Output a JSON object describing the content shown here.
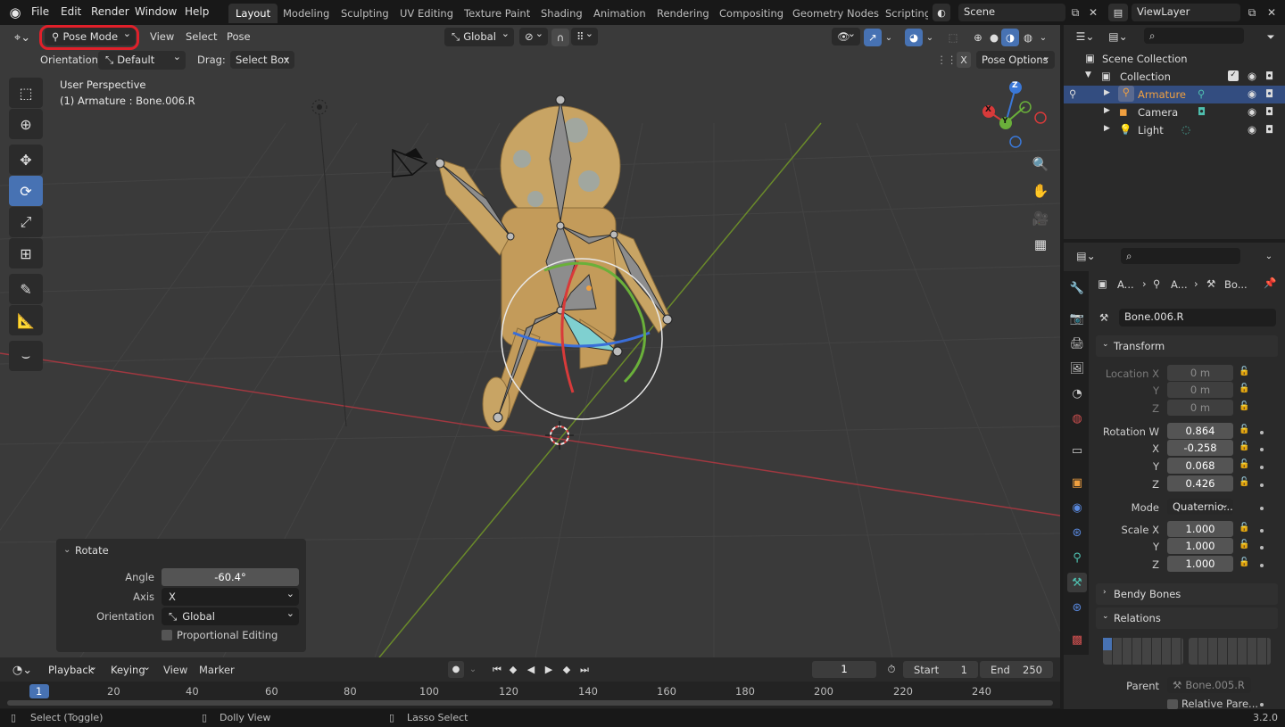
{
  "topbar": {
    "menus": [
      "File",
      "Edit",
      "Render",
      "Window",
      "Help"
    ],
    "workspaces": [
      "Layout",
      "Modeling",
      "Sculpting",
      "UV Editing",
      "Texture Paint",
      "Shading",
      "Animation",
      "Rendering",
      "Compositing",
      "Geometry Nodes",
      "Scripting"
    ],
    "active_workspace": "Layout",
    "scene": "Scene",
    "view_layer": "ViewLayer"
  },
  "viewport_header": {
    "mode": "Pose Mode",
    "menus": [
      "View",
      "Select",
      "Pose"
    ],
    "transform_orientation": "Global",
    "orientation_label": "Orientation:",
    "orientation_value": "Default",
    "drag_label": "Drag:",
    "drag_value": "Select Box",
    "x_toggle": "X",
    "pose_options": "Pose Options"
  },
  "viewport": {
    "perspective": "User Perspective",
    "active_info": "(1) Armature : Bone.006.R",
    "gizmo_axes": {
      "x": "X",
      "y": "Y",
      "z": "Z"
    }
  },
  "redo_panel": {
    "title": "Rotate",
    "angle_label": "Angle",
    "angle_value": "-60.4°",
    "axis_label": "Axis",
    "axis_value": "X",
    "orientation_label": "Orientation",
    "orientation_value": "Global",
    "proportional_label": "Proportional Editing"
  },
  "timeline": {
    "menus": [
      "Playback",
      "Keying",
      "View",
      "Marker"
    ],
    "current_frame": "1",
    "start_label": "Start",
    "start_value": "1",
    "end_label": "End",
    "end_value": "250",
    "ruler": [
      "1",
      "20",
      "40",
      "60",
      "80",
      "100",
      "120",
      "140",
      "160",
      "180",
      "200",
      "220",
      "240"
    ]
  },
  "statusbar": {
    "hint1": "Select (Toggle)",
    "hint2": "Dolly View",
    "hint3": "Lasso Select",
    "version": "3.2.0"
  },
  "outliner": {
    "root": "Scene Collection",
    "collection": "Collection",
    "items": [
      "Armature",
      "Camera",
      "Light"
    ]
  },
  "properties": {
    "breadcrumb": [
      "A...",
      "A...",
      "Bo..."
    ],
    "bone_name": "Bone.006.R",
    "transform_title": "Transform",
    "location_labels": [
      "Location X",
      "Y",
      "Z"
    ],
    "location_values": [
      "0 m",
      "0 m",
      "0 m"
    ],
    "rotation_labels": [
      "Rotation W",
      "X",
      "Y",
      "Z"
    ],
    "rotation_values": [
      "0.864",
      "-0.258",
      "0.068",
      "0.426"
    ],
    "mode_label": "Mode",
    "mode_value": "Quaternio...",
    "scale_labels": [
      "Scale X",
      "Y",
      "Z"
    ],
    "scale_values": [
      "1.000",
      "1.000",
      "1.000"
    ],
    "bendy_bones": "Bendy Bones",
    "relations": "Relations",
    "parent_label": "Parent",
    "parent_value": "Bone.005.R",
    "relative_parent": "Relative Pare..."
  },
  "colors": {
    "accent": "#4772b3",
    "highlight_circle": "#e0202a",
    "armature_orange": "#f0a040"
  }
}
